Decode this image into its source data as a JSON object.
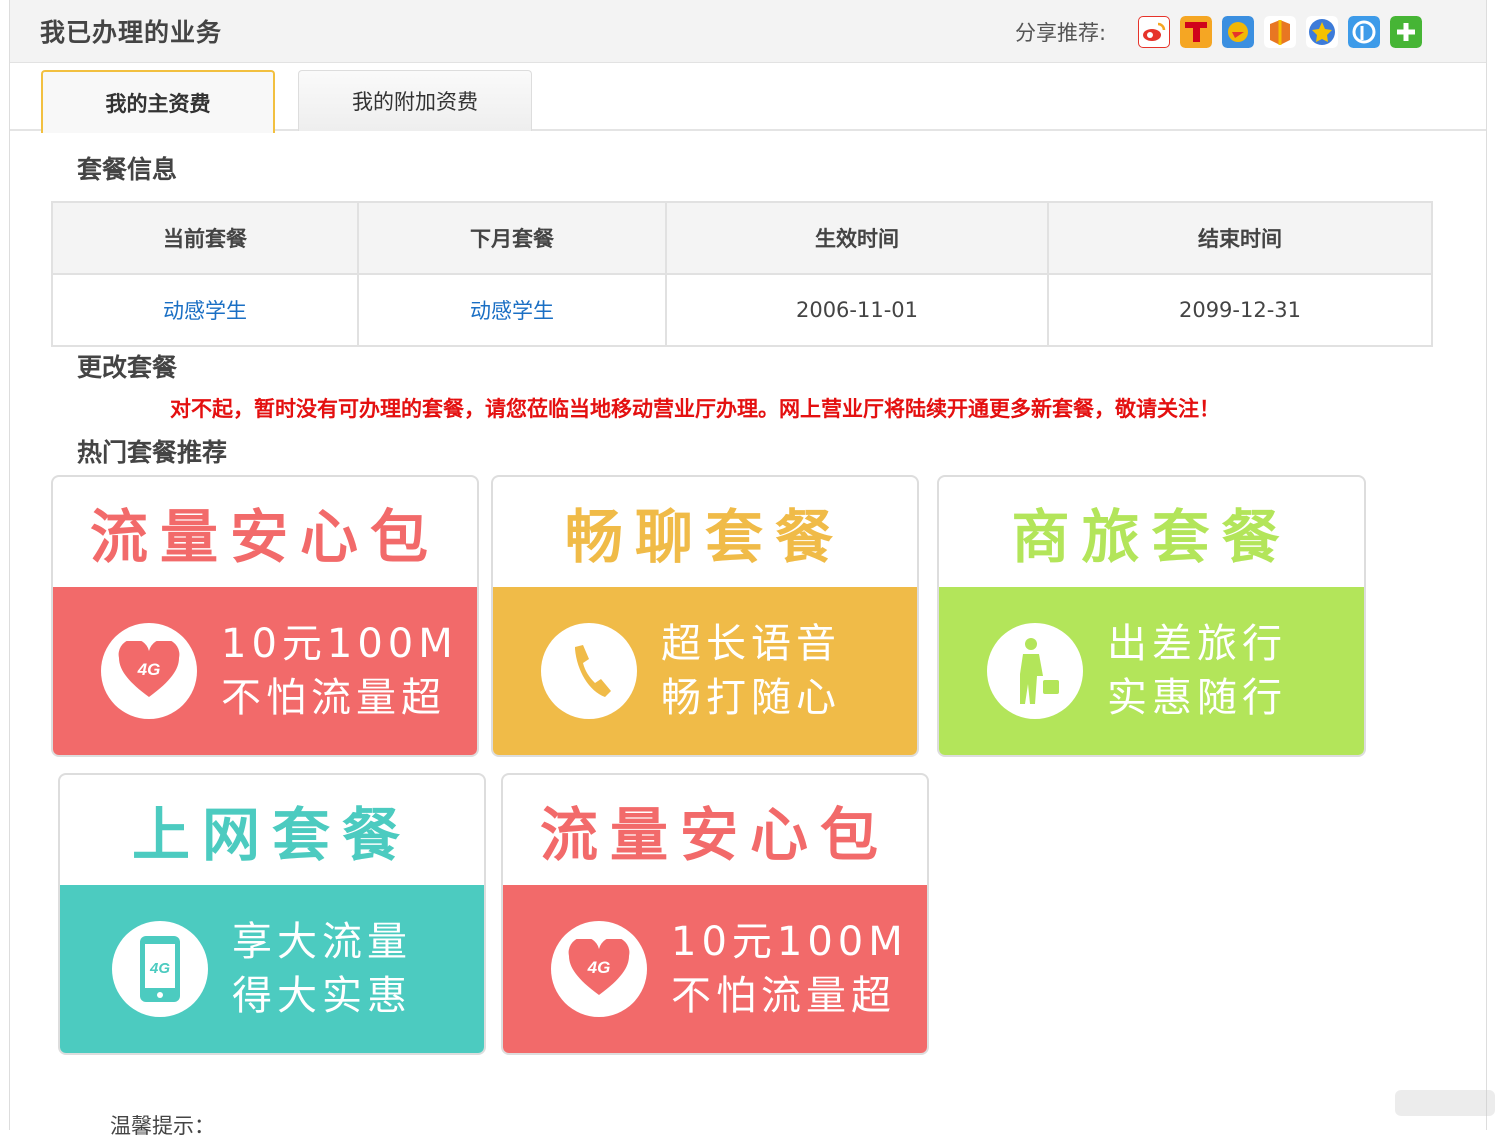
{
  "header": {
    "title": "我已办理的业务",
    "share_label": "分享推荐:",
    "share_icons": [
      {
        "name": "weibo-share-icon",
        "color": "#e6332a"
      },
      {
        "name": "tencent-weibo-share-icon",
        "color": "#f5a623"
      },
      {
        "name": "qzone-share-icon",
        "color": "#f2b705"
      },
      {
        "name": "renren-share-icon",
        "color": "#e87722"
      },
      {
        "name": "kaixin-share-icon",
        "color": "#e5a21b"
      },
      {
        "name": "pengyou-share-icon",
        "color": "#3d9be9"
      },
      {
        "name": "more-share-icon",
        "color": "#46b535"
      }
    ]
  },
  "tabs": {
    "main_fee": "我的主资费",
    "extra_fee": "我的附加资费"
  },
  "sections": {
    "plan_info": "套餐信息",
    "change_plan": "更改套餐",
    "hot_plans": "热门套餐推荐"
  },
  "plan_table": {
    "headers": [
      "当前套餐",
      "下月套餐",
      "生效时间",
      "结束时间"
    ],
    "row": {
      "current": "动感学生",
      "next_month": "动感学生",
      "start": "2006-11-01",
      "end": "2099-12-31"
    }
  },
  "notice": "对不起，暂时没有可办理的套餐，请您莅临当地移动营业厅办理。网上营业厅将陆续开通更多新套餐，敬请关注！",
  "cards": [
    {
      "title": "流量安心包",
      "line1": "10元100M",
      "line2": "不怕流量超",
      "icon": "heart-4g-icon",
      "accent": "#f26a6a"
    },
    {
      "title": "畅聊套餐",
      "line1": "超长语音",
      "line2": "畅打随心",
      "icon": "phone-icon",
      "accent": "#f0bb48"
    },
    {
      "title": "商旅套餐",
      "line1": "出差旅行",
      "line2": "实惠随行",
      "icon": "traveler-icon",
      "accent": "#b3e55a"
    },
    {
      "title": "上网套餐",
      "line1": "享大流量",
      "line2": "得大实惠",
      "icon": "mobile-4g-icon",
      "accent": "#4ccbc0"
    },
    {
      "title": "流量安心包",
      "line1": "10元100M",
      "line2": "不怕流量超",
      "icon": "heart-4g-icon",
      "accent": "#f26a6a"
    }
  ],
  "tips_label": "温馨提示："
}
